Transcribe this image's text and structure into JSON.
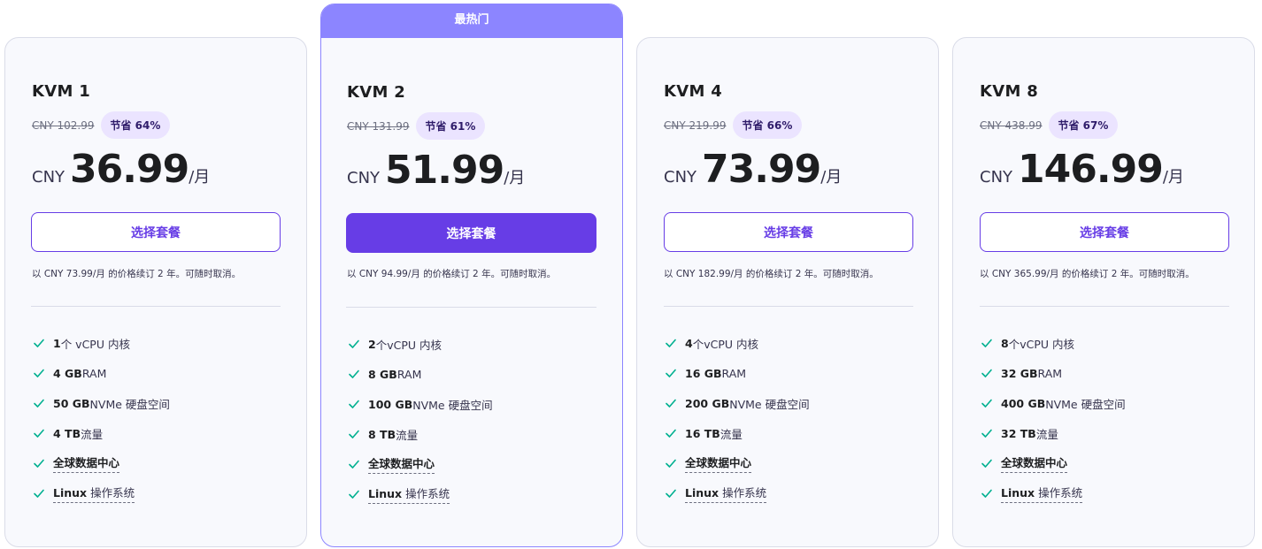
{
  "colors": {
    "accent": "#673de6",
    "popular_ribbon": "#8c85ff",
    "badge_bg": "#ebe4ff",
    "check": "#00b090"
  },
  "plans": [
    {
      "name": "KVM 1",
      "old_price": "CNY 102.99",
      "save": "节省 64%",
      "currency": "CNY",
      "amount": "36.99",
      "unit": "/月",
      "button": "选择套餐",
      "renew": "以 CNY 73.99/月 的价格续订 2 年。可随时取消。",
      "features": {
        "vcpu_num": "1",
        "vcpu_text": " 个 vCPU 内核",
        "ram_num": "4 GB",
        "ram_text": " RAM",
        "disk_num": "50 GB",
        "disk_text": " NVMe 硬盘空间",
        "traffic_num": "4 TB",
        "traffic_text": " 流量",
        "dc_text": "全球数据中心",
        "os_bold": "Linux",
        "os_text": " 操作系统"
      }
    },
    {
      "name": "KVM 2",
      "ribbon": "最热门",
      "old_price": "CNY 131.99",
      "save": "节省 61%",
      "currency": "CNY",
      "amount": "51.99",
      "unit": "/月",
      "button": "选择套餐",
      "renew": "以 CNY 94.99/月 的价格续订 2 年。可随时取消。",
      "features": {
        "vcpu_num": "2",
        "vcpu_text": " 个vCPU 内核",
        "ram_num": "8 GB",
        "ram_text": " RAM",
        "disk_num": "100 GB",
        "disk_text": " NVMe 硬盘空间",
        "traffic_num": "8 TB",
        "traffic_text": " 流量",
        "dc_text": "全球数据中心",
        "os_bold": "Linux",
        "os_text": " 操作系统"
      }
    },
    {
      "name": "KVM 4",
      "old_price": "CNY 219.99",
      "save": "节省 66%",
      "currency": "CNY",
      "amount": "73.99",
      "unit": "/月",
      "button": "选择套餐",
      "renew": "以 CNY 182.99/月 的价格续订 2 年。可随时取消。",
      "features": {
        "vcpu_num": "4",
        "vcpu_text": " 个vCPU 内核",
        "ram_num": "16 GB",
        "ram_text": " RAM",
        "disk_num": "200 GB",
        "disk_text": " NVMe 硬盘空间",
        "traffic_num": "16 TB",
        "traffic_text": " 流量",
        "dc_text": "全球数据中心",
        "os_bold": "Linux",
        "os_text": " 操作系统"
      }
    },
    {
      "name": "KVM 8",
      "old_price": "CNY 438.99",
      "save": "节省 67%",
      "currency": "CNY",
      "amount": "146.99",
      "unit": "/月",
      "button": "选择套餐",
      "renew": "以 CNY 365.99/月 的价格续订 2 年。可随时取消。",
      "features": {
        "vcpu_num": "8",
        "vcpu_text": " 个vCPU 内核",
        "ram_num": "32 GB",
        "ram_text": " RAM",
        "disk_num": "400 GB",
        "disk_text": " NVMe 硬盘空间",
        "traffic_num": "32 TB",
        "traffic_text": " 流量",
        "dc_text": "全球数据中心",
        "os_bold": "Linux",
        "os_text": " 操作系统"
      }
    }
  ]
}
